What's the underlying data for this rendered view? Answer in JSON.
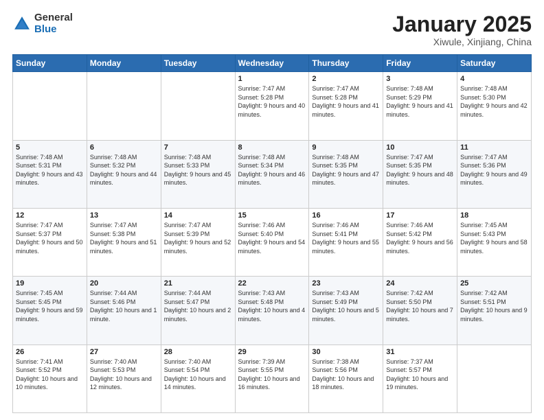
{
  "logo": {
    "general": "General",
    "blue": "Blue"
  },
  "header": {
    "title": "January 2025",
    "location": "Xiwule, Xinjiang, China"
  },
  "weekdays": [
    "Sunday",
    "Monday",
    "Tuesday",
    "Wednesday",
    "Thursday",
    "Friday",
    "Saturday"
  ],
  "weeks": [
    [
      {
        "day": "",
        "info": ""
      },
      {
        "day": "",
        "info": ""
      },
      {
        "day": "",
        "info": ""
      },
      {
        "day": "1",
        "info": "Sunrise: 7:47 AM\nSunset: 5:28 PM\nDaylight: 9 hours and 40 minutes."
      },
      {
        "day": "2",
        "info": "Sunrise: 7:47 AM\nSunset: 5:28 PM\nDaylight: 9 hours and 41 minutes."
      },
      {
        "day": "3",
        "info": "Sunrise: 7:48 AM\nSunset: 5:29 PM\nDaylight: 9 hours and 41 minutes."
      },
      {
        "day": "4",
        "info": "Sunrise: 7:48 AM\nSunset: 5:30 PM\nDaylight: 9 hours and 42 minutes."
      }
    ],
    [
      {
        "day": "5",
        "info": "Sunrise: 7:48 AM\nSunset: 5:31 PM\nDaylight: 9 hours and 43 minutes."
      },
      {
        "day": "6",
        "info": "Sunrise: 7:48 AM\nSunset: 5:32 PM\nDaylight: 9 hours and 44 minutes."
      },
      {
        "day": "7",
        "info": "Sunrise: 7:48 AM\nSunset: 5:33 PM\nDaylight: 9 hours and 45 minutes."
      },
      {
        "day": "8",
        "info": "Sunrise: 7:48 AM\nSunset: 5:34 PM\nDaylight: 9 hours and 46 minutes."
      },
      {
        "day": "9",
        "info": "Sunrise: 7:48 AM\nSunset: 5:35 PM\nDaylight: 9 hours and 47 minutes."
      },
      {
        "day": "10",
        "info": "Sunrise: 7:47 AM\nSunset: 5:35 PM\nDaylight: 9 hours and 48 minutes."
      },
      {
        "day": "11",
        "info": "Sunrise: 7:47 AM\nSunset: 5:36 PM\nDaylight: 9 hours and 49 minutes."
      }
    ],
    [
      {
        "day": "12",
        "info": "Sunrise: 7:47 AM\nSunset: 5:37 PM\nDaylight: 9 hours and 50 minutes."
      },
      {
        "day": "13",
        "info": "Sunrise: 7:47 AM\nSunset: 5:38 PM\nDaylight: 9 hours and 51 minutes."
      },
      {
        "day": "14",
        "info": "Sunrise: 7:47 AM\nSunset: 5:39 PM\nDaylight: 9 hours and 52 minutes."
      },
      {
        "day": "15",
        "info": "Sunrise: 7:46 AM\nSunset: 5:40 PM\nDaylight: 9 hours and 54 minutes."
      },
      {
        "day": "16",
        "info": "Sunrise: 7:46 AM\nSunset: 5:41 PM\nDaylight: 9 hours and 55 minutes."
      },
      {
        "day": "17",
        "info": "Sunrise: 7:46 AM\nSunset: 5:42 PM\nDaylight: 9 hours and 56 minutes."
      },
      {
        "day": "18",
        "info": "Sunrise: 7:45 AM\nSunset: 5:43 PM\nDaylight: 9 hours and 58 minutes."
      }
    ],
    [
      {
        "day": "19",
        "info": "Sunrise: 7:45 AM\nSunset: 5:45 PM\nDaylight: 9 hours and 59 minutes."
      },
      {
        "day": "20",
        "info": "Sunrise: 7:44 AM\nSunset: 5:46 PM\nDaylight: 10 hours and 1 minute."
      },
      {
        "day": "21",
        "info": "Sunrise: 7:44 AM\nSunset: 5:47 PM\nDaylight: 10 hours and 2 minutes."
      },
      {
        "day": "22",
        "info": "Sunrise: 7:43 AM\nSunset: 5:48 PM\nDaylight: 10 hours and 4 minutes."
      },
      {
        "day": "23",
        "info": "Sunrise: 7:43 AM\nSunset: 5:49 PM\nDaylight: 10 hours and 5 minutes."
      },
      {
        "day": "24",
        "info": "Sunrise: 7:42 AM\nSunset: 5:50 PM\nDaylight: 10 hours and 7 minutes."
      },
      {
        "day": "25",
        "info": "Sunrise: 7:42 AM\nSunset: 5:51 PM\nDaylight: 10 hours and 9 minutes."
      }
    ],
    [
      {
        "day": "26",
        "info": "Sunrise: 7:41 AM\nSunset: 5:52 PM\nDaylight: 10 hours and 10 minutes."
      },
      {
        "day": "27",
        "info": "Sunrise: 7:40 AM\nSunset: 5:53 PM\nDaylight: 10 hours and 12 minutes."
      },
      {
        "day": "28",
        "info": "Sunrise: 7:40 AM\nSunset: 5:54 PM\nDaylight: 10 hours and 14 minutes."
      },
      {
        "day": "29",
        "info": "Sunrise: 7:39 AM\nSunset: 5:55 PM\nDaylight: 10 hours and 16 minutes."
      },
      {
        "day": "30",
        "info": "Sunrise: 7:38 AM\nSunset: 5:56 PM\nDaylight: 10 hours and 18 minutes."
      },
      {
        "day": "31",
        "info": "Sunrise: 7:37 AM\nSunset: 5:57 PM\nDaylight: 10 hours and 19 minutes."
      },
      {
        "day": "",
        "info": ""
      }
    ]
  ]
}
